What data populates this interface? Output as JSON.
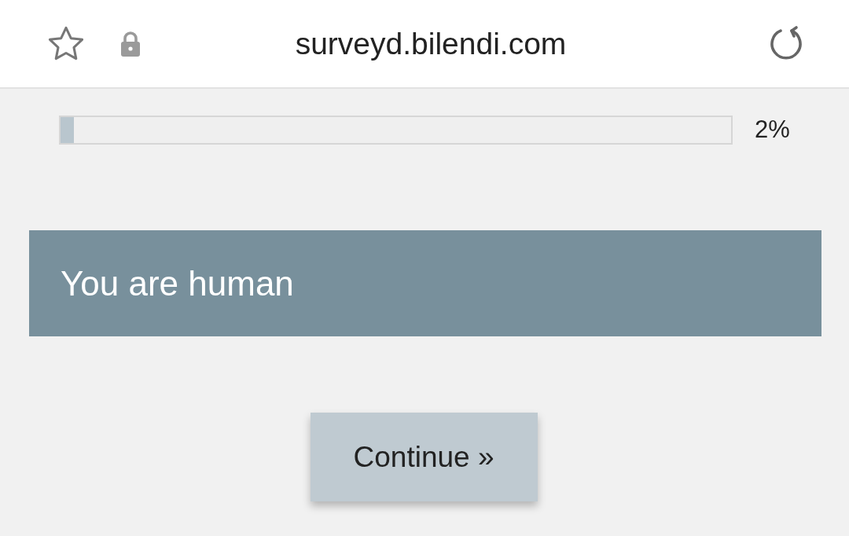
{
  "address_bar": {
    "url": "surveyd.bilendi.com",
    "secure": true
  },
  "progress": {
    "level": 0.02,
    "reading": "2%"
  },
  "banner": {
    "title": "You are human"
  },
  "button": {
    "label": "Continue »"
  }
}
